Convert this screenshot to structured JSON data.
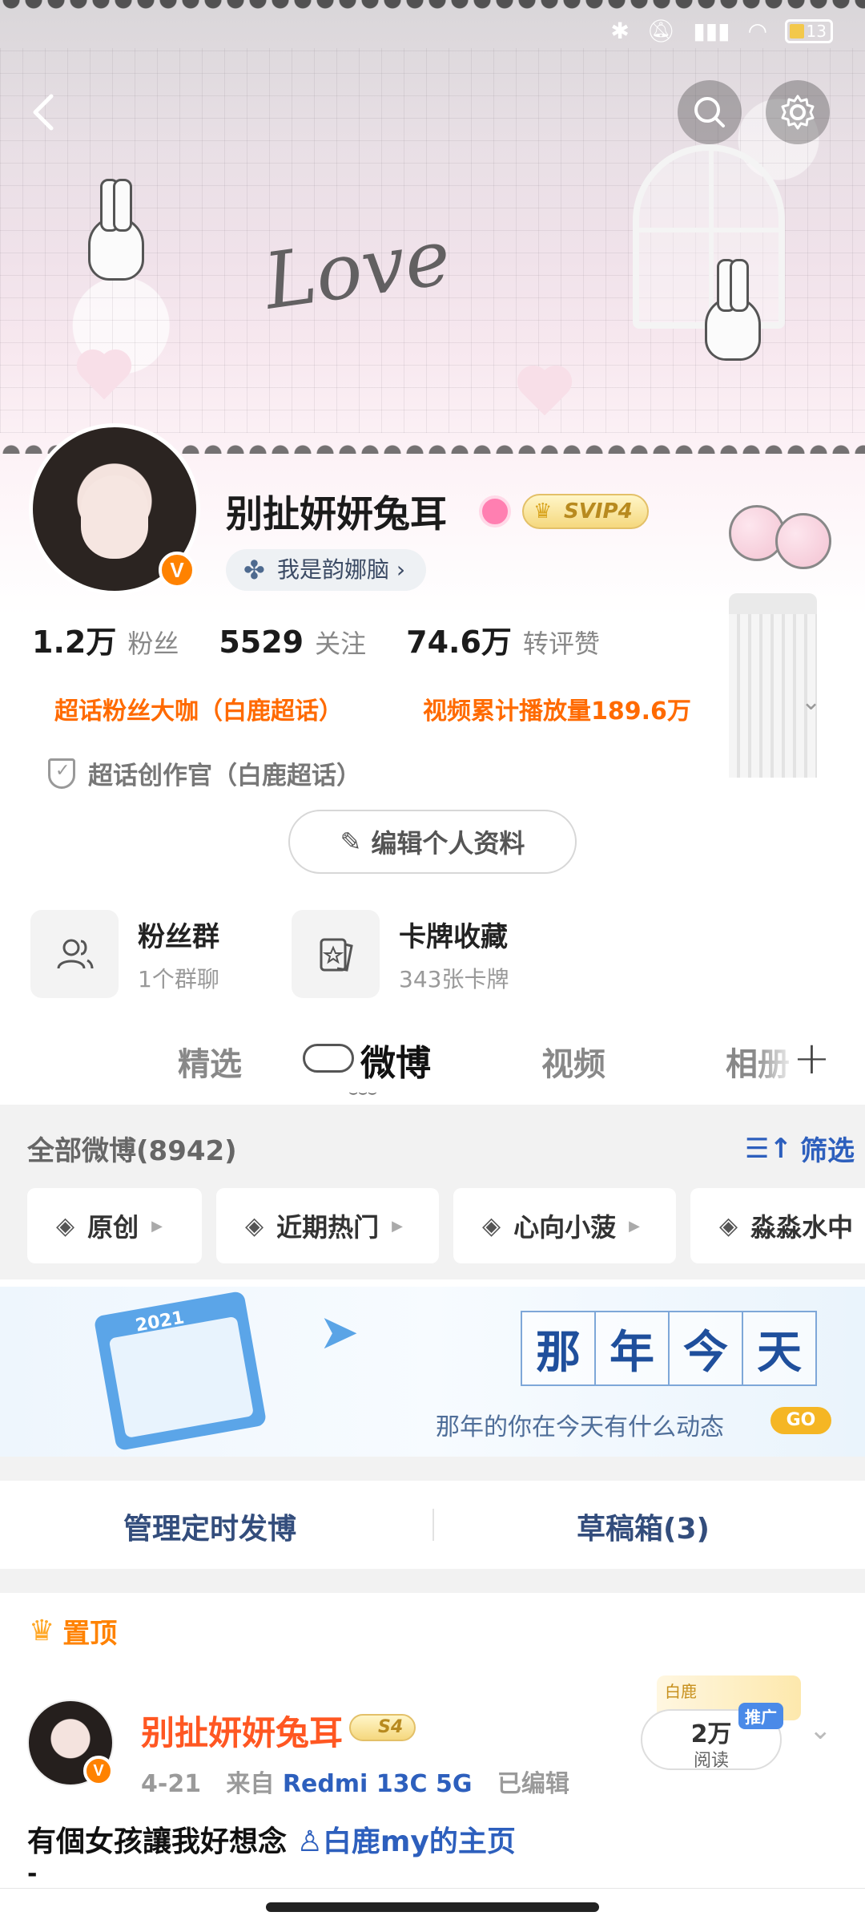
{
  "profile": {
    "name": "别扯妍妍兔耳",
    "svip_badge": "SVIP4",
    "tag": "我是韵娜脑",
    "verified_mark": "V",
    "stats": [
      {
        "value": "1.2万",
        "label": "粉丝"
      },
      {
        "value": "5529",
        "label": "关注"
      },
      {
        "value": "74.6万",
        "label": "转评赞"
      }
    ],
    "honors": [
      "超话粉丝大咖（白鹿超话）",
      "视频累计播放量189.6万"
    ],
    "creator_title": "超话创作官（白鹿超话）",
    "edit_button": "编辑个人资料"
  },
  "features": [
    {
      "title": "粉丝群",
      "sub": "1个群聊",
      "icon": "group-icon"
    },
    {
      "title": "卡牌收藏",
      "sub": "343张卡牌",
      "icon": "card-icon"
    }
  ],
  "tabs": [
    "精选",
    "微博",
    "视频",
    "相册"
  ],
  "active_tab": "微博",
  "weibo": {
    "all_label": "全部微博(8942)",
    "filter_label": "筛选",
    "chips": [
      "原创",
      "近期热门",
      "心向小菠",
      "淼淼水中"
    ]
  },
  "memory_banner": {
    "title_chars": [
      "那",
      "年",
      "今",
      "天"
    ],
    "subtitle": "那年的你在今天有什么动态",
    "go": "GO",
    "year": "2021"
  },
  "manage": {
    "scheduled": "管理定时发博",
    "drafts": "草稿箱(3)"
  },
  "pinned_post": {
    "pin_label": "置顶",
    "author": "别扯妍妍兔耳",
    "level_badge": "S4",
    "date": "4-21",
    "source_prefix": "来自",
    "device": "Redmi 13C 5G",
    "edited": "已编辑",
    "reads_value": "2万",
    "reads_label": "阅读",
    "promo": "推广",
    "fan_tag": "白鹿",
    "text": "有個女孩讓我好想念",
    "link": "白鹿my的主页",
    "tail": "-"
  },
  "status_bar": {
    "battery": "13"
  },
  "colors": {
    "accent_orange": "#ff8200",
    "link_blue": "#2d5fbd",
    "name_red": "#ff5722"
  }
}
